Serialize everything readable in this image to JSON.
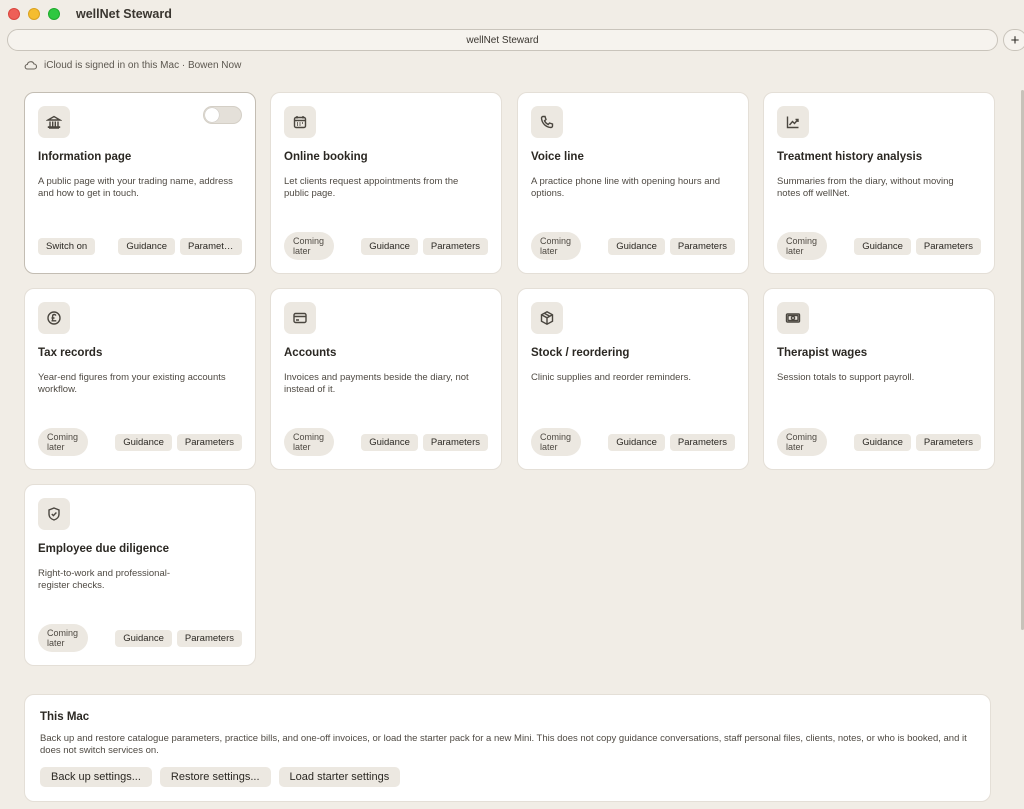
{
  "window": {
    "title": "wellNet Steward"
  },
  "address_bar": {
    "title": "wellNet Steward",
    "new_tab": "+"
  },
  "status": {
    "icloud_text": "iCloud is signed in on this Mac · Bowen Now"
  },
  "labels": {
    "coming_later": "Coming later",
    "guidance": "Guidance",
    "parameters": "Parameters",
    "parameters_truncated": "Paramete...",
    "switch_on": "Switch on"
  },
  "cards": [
    {
      "title": "Information page",
      "description": "A public page with your trading name, address and how to get in touch.",
      "icon": "bank-icon",
      "state": "available",
      "toggle_on": false
    },
    {
      "title": "Online booking",
      "description": "Let clients request appointments from the public page.",
      "icon": "calendar-icon",
      "state": "coming-later"
    },
    {
      "title": "Voice line",
      "description": "A practice phone line with opening hours and options.",
      "icon": "phone-icon",
      "state": "coming-later"
    },
    {
      "title": "Treatment history analysis",
      "description": "Summaries from the diary, without moving notes off wellNet.",
      "icon": "chart-up-icon",
      "state": "coming-later"
    },
    {
      "title": "Tax records",
      "description": "Year-end figures from your existing accounts workflow.",
      "icon": "pound-icon",
      "state": "coming-later"
    },
    {
      "title": "Accounts",
      "description": "Invoices and payments beside the diary, not instead of it.",
      "icon": "credit-card-icon",
      "state": "coming-later"
    },
    {
      "title": "Stock / reordering",
      "description": "Clinic supplies and reorder reminders.",
      "icon": "box-icon",
      "state": "coming-later"
    },
    {
      "title": "Therapist wages",
      "description": "Session totals to support payroll.",
      "icon": "banknote-icon",
      "state": "coming-later"
    },
    {
      "title": "Employee due diligence",
      "description": "Right-to-work and professional-register checks.",
      "icon": "shield-check-icon",
      "state": "coming-later"
    }
  ],
  "this_mac": {
    "title": "This Mac",
    "description": "Back up and restore catalogue parameters, practice bills, and one-off invoices, or load the starter pack for a new Mini. This does not copy guidance conversations, staff personal files, clients, notes, or who is booked, and it does not switch services on.",
    "buttons": {
      "backup": "Back up settings...",
      "restore": "Restore settings...",
      "load_starter": "Load starter settings"
    }
  }
}
